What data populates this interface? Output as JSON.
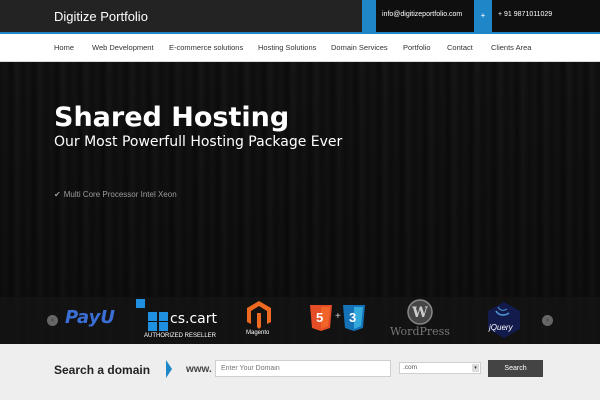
{
  "header": {
    "brand": "Digitize Portfolio",
    "email": "info@digitizeportfolio.com",
    "phone": "+ 91 9871011029",
    "phone_icon": "+"
  },
  "nav": {
    "items": [
      "Home",
      "Web Development",
      "E-commerce solutions",
      "Hosting Solutions",
      "Domain Services",
      "Portfolio",
      "Contact",
      "Clients Area"
    ]
  },
  "hero": {
    "title": "Shared Hosting",
    "subtitle": "Our Most Powerfull Hosting Package Ever",
    "feature": "Multi Core Processor Intel Xeon",
    "feature_icon": "✔"
  },
  "logos": {
    "payu": "PayU",
    "cscart": "cs.cart",
    "cscart_sub": "AUTHORIZED RESELLER",
    "magento": "Magento",
    "html5": "5",
    "css3": "3",
    "plus": "+",
    "wordpress": "WordPress",
    "jquery": "jQuery",
    "prev": "‹",
    "next": "›"
  },
  "search": {
    "label": "Search a domain",
    "www": "www.",
    "placeholder": "Enter Your Domain",
    "tld": ".com",
    "tld_arrow": "▾",
    "button": "Search"
  },
  "colors": {
    "accent": "#1f86c8"
  }
}
